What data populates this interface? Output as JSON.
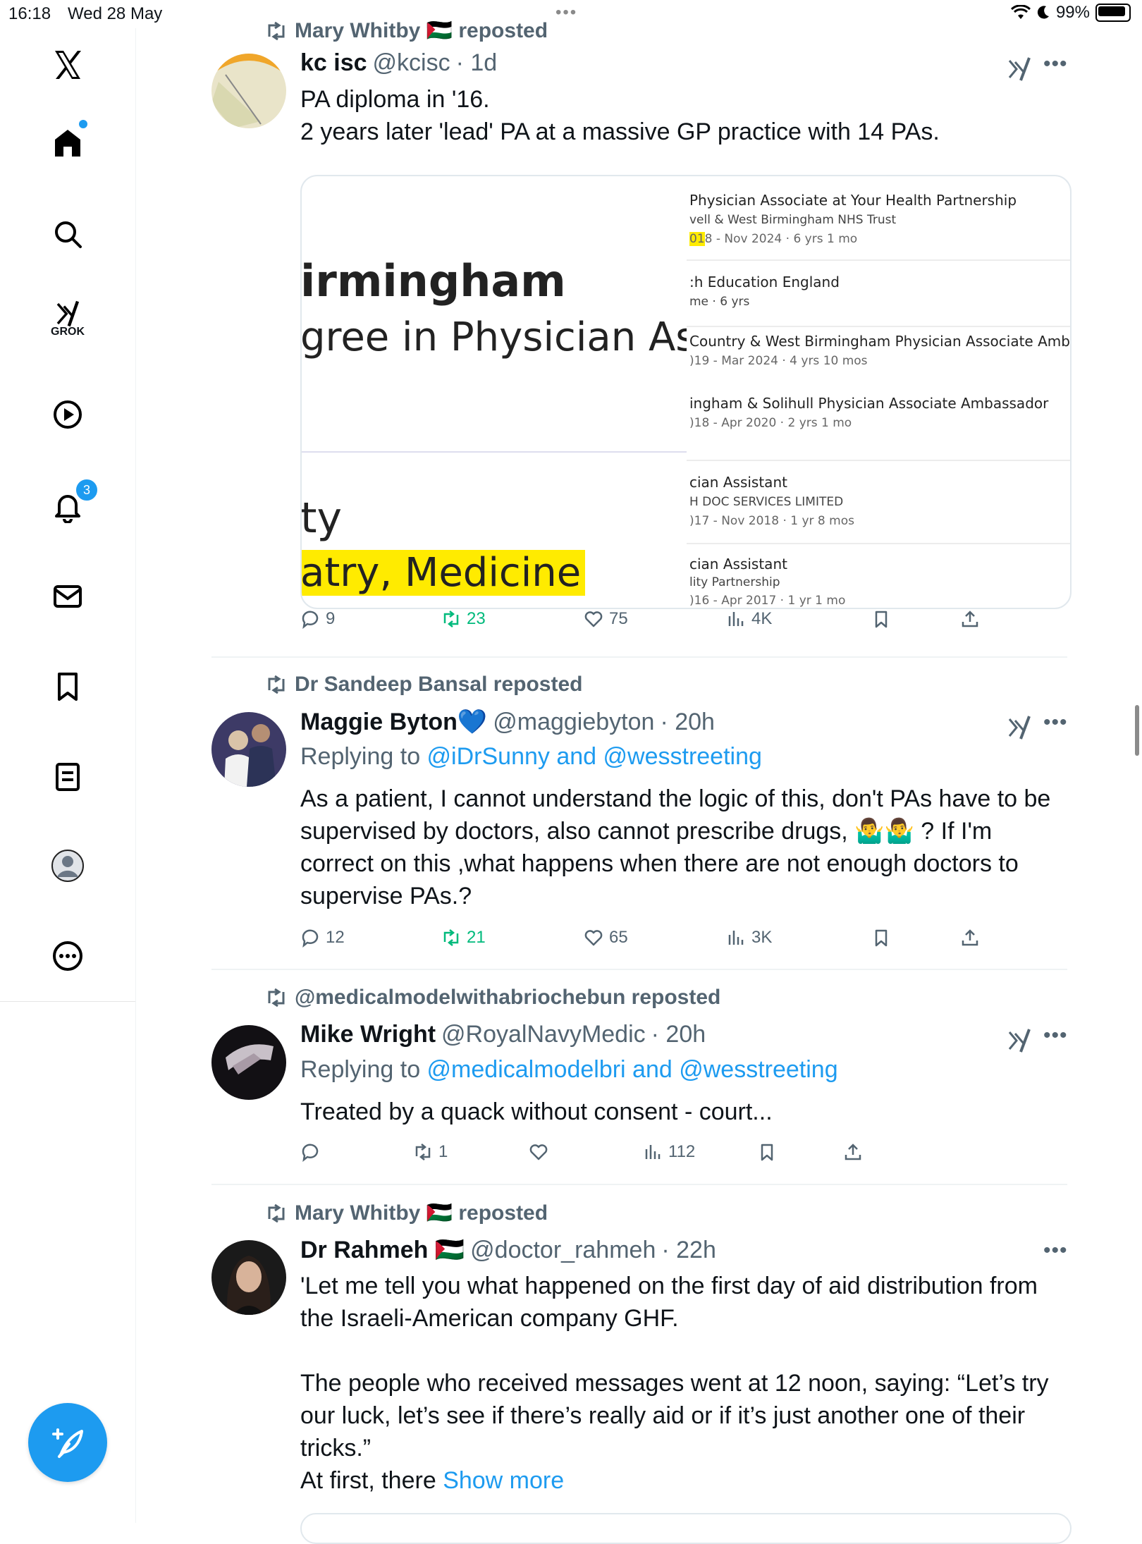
{
  "status_bar": {
    "time": "16:18",
    "date": "Wed 28 May",
    "multitask": "•••",
    "battery": "99%"
  },
  "sidebar": {
    "items": [
      {
        "name": "x-logo-icon"
      },
      {
        "name": "home-icon"
      },
      {
        "name": "search-icon"
      },
      {
        "name": "grok-icon",
        "label": "GROK"
      },
      {
        "name": "video-icon"
      },
      {
        "name": "notifications-icon",
        "badge": "3"
      },
      {
        "name": "messages-icon"
      },
      {
        "name": "bookmarks-icon"
      },
      {
        "name": "lists-icon"
      },
      {
        "name": "profile-icon"
      },
      {
        "name": "more-icon"
      }
    ]
  },
  "colors": {
    "accent": "#1d9bf0",
    "retweet_green": "#00ba7c",
    "muted": "#536471"
  },
  "tweets": [
    {
      "repost_by": "Mary Whitby 🇵🇸 reposted",
      "name": "kc isc",
      "handle": "@kcisc",
      "time": "· 1d",
      "text_lines": [
        "PA diploma in '16.",
        "2 years later 'lead' PA at a massive GP practice with 14 PAs."
      ],
      "media": {
        "left_text": [
          "irmingham",
          "gree in Physician Associ",
          "ty",
          "atry, Medicine"
        ],
        "jobs": [
          {
            "title": "Physician Associate at Your Health Partnership",
            "sub": "vell & West Birmingham NHS Trust",
            "dates": "018 - Nov 2024 · 6 yrs 1 mo"
          },
          {
            "title": ":h Education England",
            "sub": "me · 6 yrs",
            "dates": ""
          },
          {
            "title": " Country & West Birmingham Physician Associate Amba",
            "sub": "",
            "dates": ")19 - Mar 2024 · 4 yrs 10 mos"
          },
          {
            "title": "ingham & Solihull Physician Associate Ambassador",
            "sub": "",
            "dates": ")18 - Apr 2020 · 2 yrs 1 mo"
          },
          {
            "title": "cian Assistant",
            "sub": "H DOC SERVICES LIMITED",
            "dates": ")17 - Nov 2018 · 1 yr 8 mos"
          },
          {
            "title": "cian Assistant",
            "sub": "lity Partnership",
            "dates": ")16 - Apr 2017 · 1 yr 1 mo"
          }
        ]
      },
      "stats": {
        "replies": "9",
        "reposts": "23",
        "likes": "75",
        "views": "4K"
      }
    },
    {
      "repost_by": "Dr Sandeep Bansal reposted",
      "name": "Maggie Byton💙",
      "handle": "@maggiebyton",
      "time": "· 20h",
      "reply_prefix": "Replying to ",
      "reply_targets": "@iDrSunny and @wesstreeting",
      "text_lines": [
        "As a patient, I cannot understand the logic of this, don't PAs have to be",
        "supervised by doctors, also cannot prescribe drugs, 🤷‍♂️🤷‍♂️ ? If I'm",
        "correct on this ,what happens when there are not enough doctors to",
        "supervise PAs.?"
      ],
      "stats": {
        "replies": "12",
        "reposts": "21",
        "likes": "65",
        "views": "3K"
      }
    },
    {
      "repost_by": "@medicalmodelwithabriochebun reposted",
      "name": "Mike Wright",
      "handle": "@RoyalNavyMedic",
      "time": "· 20h",
      "reply_prefix": "Replying to ",
      "reply_targets": "@medicalmodelbri and @wesstreeting",
      "text_lines": [
        "Treated by a quack without consent - court..."
      ],
      "stats": {
        "replies": "",
        "reposts": "1",
        "likes": "",
        "views": "112"
      }
    },
    {
      "repost_by": "Mary Whitby 🇵🇸 reposted",
      "name": "Dr Rahmeh 🇵🇸",
      "handle": "@doctor_rahmeh",
      "time": "· 22h",
      "text_lines": [
        "'Let me tell you what happened on the first day of aid distribution from",
        "the Israeli-American company GHF.",
        "",
        "The people who received messages went at 12 noon, saying: “Let’s try",
        "our luck, let’s see if there’s really aid or if it’s just another one of their",
        "tricks.”"
      ],
      "last_line": "At first, there ",
      "show_more": "Show more"
    }
  ]
}
